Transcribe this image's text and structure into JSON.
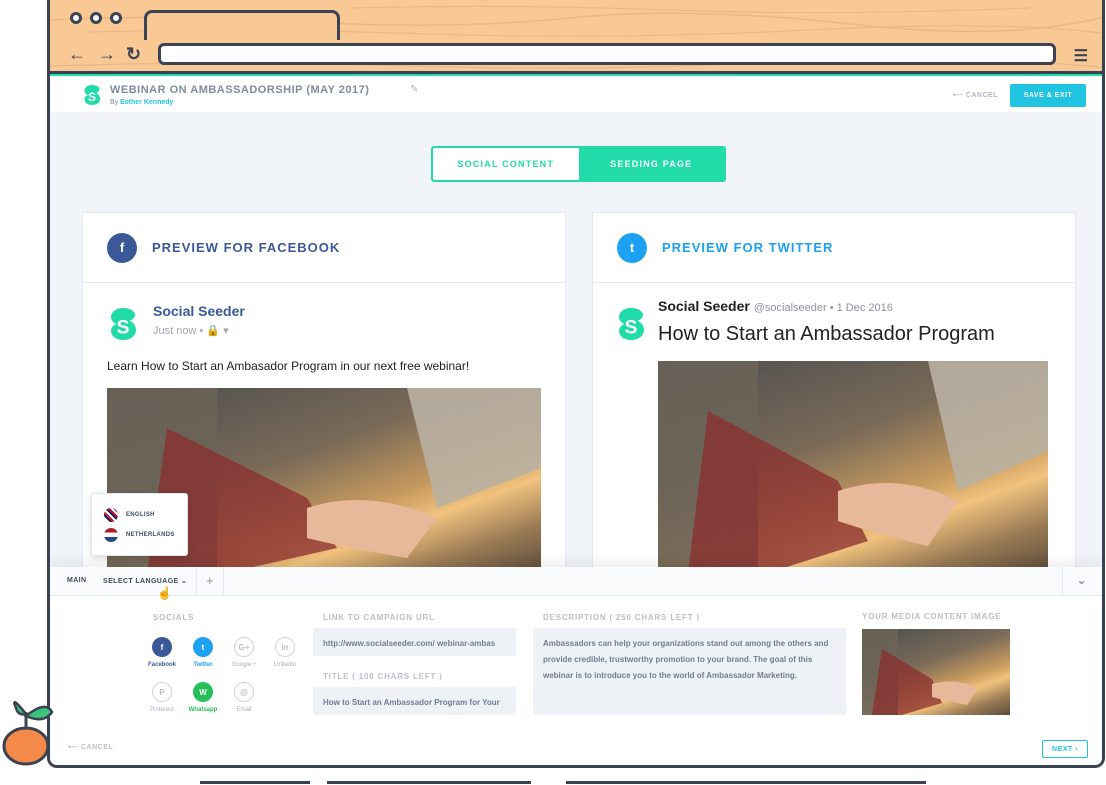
{
  "topbar": {
    "title": "WEBINAR ON AMBASSADORSHIP (MAY 2017)",
    "by_prefix": "By ",
    "author": "Esther Kennedy",
    "cancel_label": "⟵ CANCEL",
    "save_label": "SAVE & EXIT"
  },
  "toggle": {
    "left": "SOCIAL CONTENT",
    "right": "SEEDING PAGE",
    "active": "right"
  },
  "facebook": {
    "heading": "PREVIEW FOR FACEBOOK",
    "name": "Social Seeder",
    "time": "Just now • 🔒 ▾",
    "text": "Learn How to Start an Ambasador Program in our next free webinar!"
  },
  "twitter": {
    "heading": "PREVIEW FOR TWITTER",
    "name": "Social Seeder",
    "handle": "@socialseeder • 1 Dec 2016",
    "headline": "How to Start an Ambassador Program"
  },
  "language_menu": [
    "ENGLISH",
    "NETHERLANDS"
  ],
  "panel": {
    "tab_main": "MAIN",
    "tab_select": "SELECT LANGUAGE ⌄",
    "tab_add": "+",
    "socials_label": "SOCIALS",
    "socials": [
      {
        "name": "Facebook",
        "glyph": "f",
        "active": true,
        "color": "#3b5998"
      },
      {
        "name": "Twitter",
        "glyph": "t",
        "active": true,
        "color": "#1da1f2"
      },
      {
        "name": "Google +",
        "glyph": "G+",
        "active": false,
        "color": "#b7c1cd"
      },
      {
        "name": "Linkedin",
        "glyph": "in",
        "active": false,
        "color": "#b7c1cd"
      },
      {
        "name": "Pinterest",
        "glyph": "P",
        "active": false,
        "color": "#b7c1cd"
      },
      {
        "name": "Whatsapp",
        "glyph": "W",
        "active": true,
        "color": "#25c05a"
      },
      {
        "name": "Email",
        "glyph": "@",
        "active": false,
        "color": "#b7c1cd"
      }
    ],
    "link_label": "LINK TO CAMPAIGN URL",
    "link_value": "http://www.socialseeder.com/ webinar-ambas",
    "title_label": "TITLE ( 100 CHARS LEFT )",
    "title_value": "How to Start an Ambassador Program for Your",
    "desc_label": "DESCRIPTION ( 250 CHARS LEFT )",
    "desc_value": "Ambassadors can help your organizations stand out among the others and provide credible, trustworthy promotion to your brand. The goal of this webinar is to introduce you to the world of Ambassador Marketing.",
    "media_label": "YOUR MEDIA CONTENT IMAGE",
    "cancel_label": "⟵ CANCEL",
    "next_label": "NEXT ›"
  },
  "colors": {
    "accent": "#21dca8",
    "cyan": "#21c4e0",
    "facebook": "#3b5998",
    "twitter": "#1da1f2",
    "chrome": "#f9c995"
  }
}
